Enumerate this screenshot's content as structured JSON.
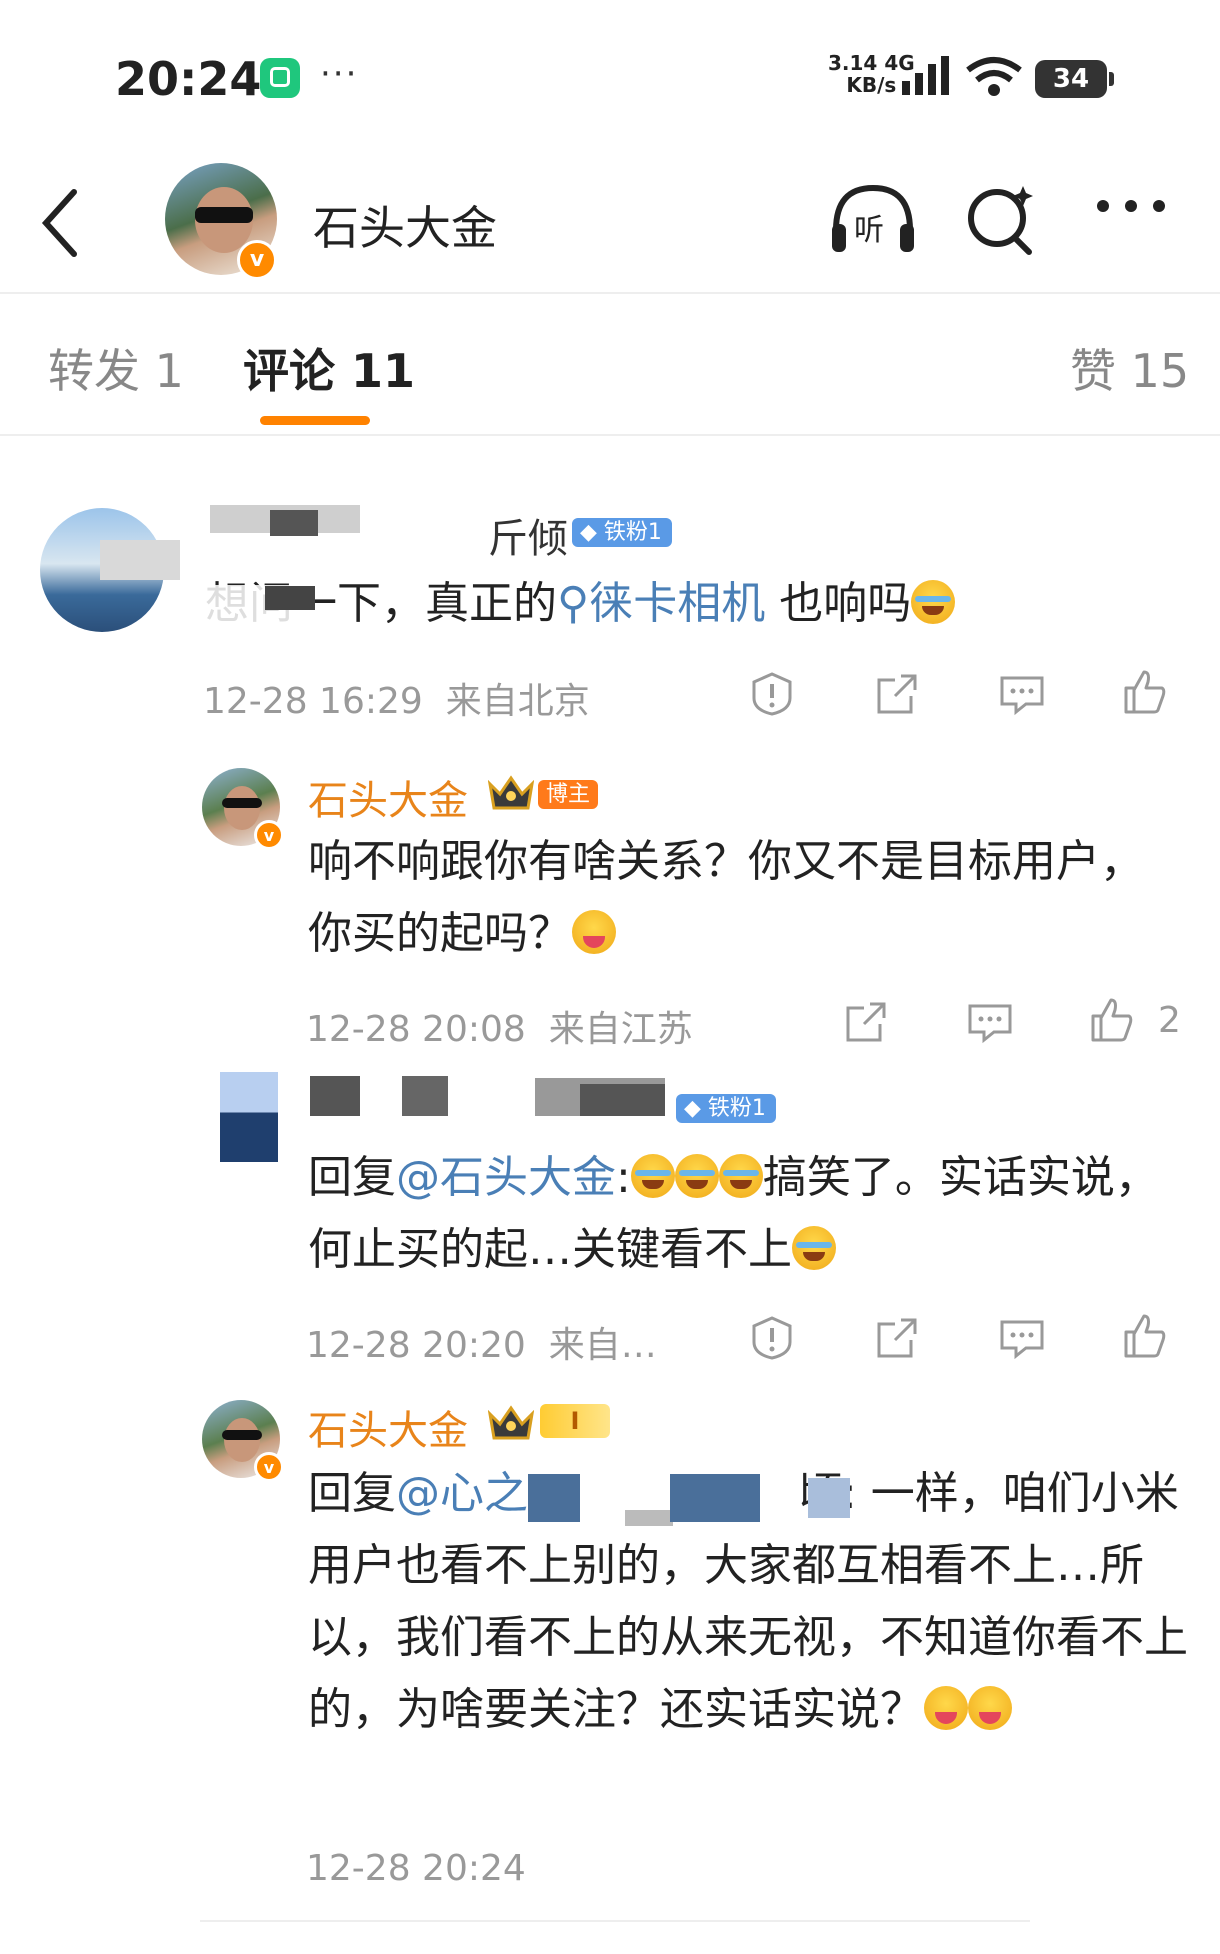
{
  "status": {
    "time": "20:24",
    "speed_value": "3.14",
    "speed_unit": "KB/s",
    "network": "4G",
    "battery": "34"
  },
  "header": {
    "title": "石头大金"
  },
  "tabs": [
    {
      "label": "转发 1"
    },
    {
      "label": "评论 11"
    },
    {
      "label": "赞 15"
    }
  ],
  "comments": [
    {
      "name_tail": "斤倾",
      "fan_badge": "铁粉1",
      "text_pre": "想问一下，真正的",
      "topic": "徕卡相机",
      "text_post": "也响吗",
      "time": "12-28 16:29",
      "location": "来自北京"
    },
    {
      "name": "石头大金",
      "host_badge": "博主",
      "text": "响不响跟你有啥关系？你又不是目标用户，你买的起吗？",
      "time": "12-28 20:08",
      "location": "来自江苏",
      "likes": "2"
    },
    {
      "fan_badge": "铁粉1",
      "reply_prefix": "回复",
      "mention": "@石头大金",
      "text": "搞笑了。实话实说，何止买的起…关键看不上",
      "time": "12-28 20:20",
      "location": "来自…"
    },
    {
      "name": "石头大金",
      "level_badge": "I",
      "reply_prefix": "回复",
      "mention": "@心之",
      "text_a": "顷: 一样，咱们小",
      "text_b": "米用户也看不上别的，大家都互相看不上…所以，我们看不上的从来无视，不知道你看不上的，为啥要关注？还实话实说？",
      "time": "12-28 20:24"
    }
  ],
  "icons": {
    "back": "chevron-left-icon",
    "listen": "headphones-icon",
    "search": "search-icon",
    "more": "more-dots-icon",
    "report": "report-icon",
    "share": "share-icon",
    "comment": "comment-icon",
    "like": "thumbs-up-icon"
  },
  "colors": {
    "accent": "#ff8200",
    "link": "#4a7fb6",
    "name_orange": "#e8841a",
    "fan_badge": "#5a9ae6"
  }
}
